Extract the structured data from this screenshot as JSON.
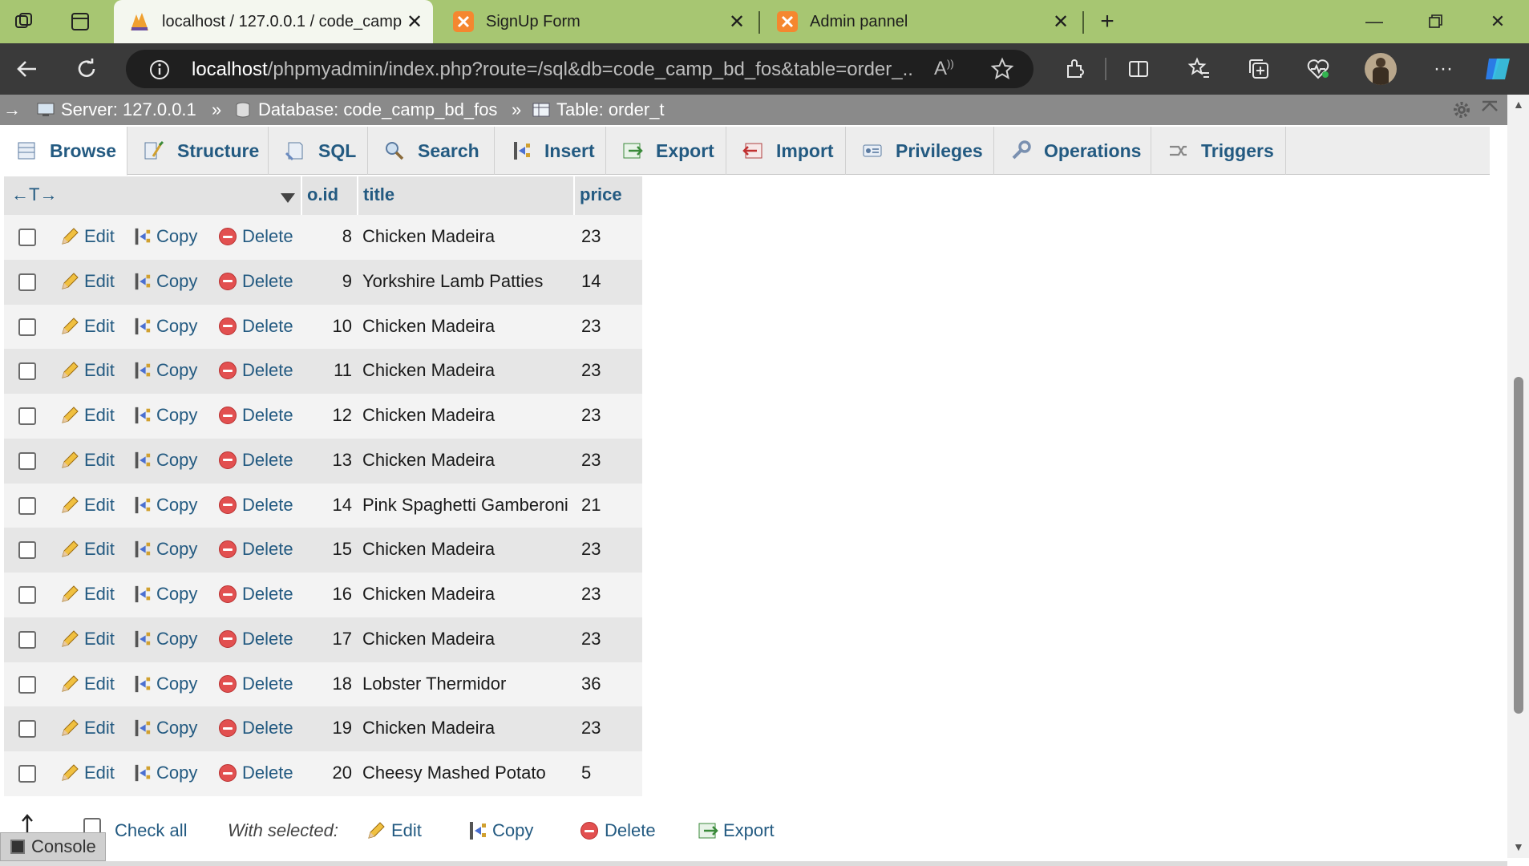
{
  "browser": {
    "tabs": [
      {
        "title": "localhost / 127.0.0.1 / code_camp",
        "icon": "phpmyadmin-icon",
        "active": true
      },
      {
        "title": "SignUp Form",
        "icon": "xampp-icon",
        "active": false
      },
      {
        "title": "Admin pannel",
        "icon": "xampp-icon",
        "active": false
      }
    ],
    "address": {
      "host": "localhost",
      "path": "/phpmyadmin/index.php?route=/sql&db=code_camp_bd_fos&table=order_..."
    },
    "accent": "#a7c672"
  },
  "breadcrumb": {
    "arrow": "→",
    "server": "Server: 127.0.0.1",
    "database": "Database: code_camp_bd_fos",
    "table": "Table: order_t",
    "sep": "»"
  },
  "tabs": [
    {
      "label": "Browse",
      "icon": "browse-icon"
    },
    {
      "label": "Structure",
      "icon": "structure-icon"
    },
    {
      "label": "SQL",
      "icon": "sql-icon"
    },
    {
      "label": "Search",
      "icon": "search-icon"
    },
    {
      "label": "Insert",
      "icon": "insert-icon"
    },
    {
      "label": "Export",
      "icon": "export-icon"
    },
    {
      "label": "Import",
      "icon": "import-icon"
    },
    {
      "label": "Privileges",
      "icon": "privileges-icon"
    },
    {
      "label": "Operations",
      "icon": "operations-icon"
    },
    {
      "label": "Triggers",
      "icon": "triggers-icon"
    }
  ],
  "table": {
    "columns": {
      "toggle": "←T→",
      "id": "o.id",
      "title": "title",
      "price": "price"
    },
    "action_labels": {
      "edit": "Edit",
      "copy": "Copy",
      "delete": "Delete"
    },
    "rows": [
      {
        "id": "8",
        "title": "Chicken Madeira",
        "price": "23"
      },
      {
        "id": "9",
        "title": "Yorkshire Lamb Patties",
        "price": "14"
      },
      {
        "id": "10",
        "title": "Chicken Madeira",
        "price": "23"
      },
      {
        "id": "11",
        "title": "Chicken Madeira",
        "price": "23"
      },
      {
        "id": "12",
        "title": "Chicken Madeira",
        "price": "23"
      },
      {
        "id": "13",
        "title": "Chicken Madeira",
        "price": "23"
      },
      {
        "id": "14",
        "title": "Pink Spaghetti Gamberoni",
        "price": "21"
      },
      {
        "id": "15",
        "title": "Chicken Madeira",
        "price": "23"
      },
      {
        "id": "16",
        "title": "Chicken Madeira",
        "price": "23"
      },
      {
        "id": "17",
        "title": "Chicken Madeira",
        "price": "23"
      },
      {
        "id": "18",
        "title": "Lobster Thermidor",
        "price": "36"
      },
      {
        "id": "19",
        "title": "Chicken Madeira",
        "price": "23"
      },
      {
        "id": "20",
        "title": "Cheesy Mashed Potato",
        "price": "5"
      }
    ]
  },
  "bottom": {
    "check_all": "Check all",
    "with_selected": "With selected:",
    "edit": "Edit",
    "copy": "Copy",
    "delete": "Delete",
    "export": "Export",
    "console": "Console"
  }
}
